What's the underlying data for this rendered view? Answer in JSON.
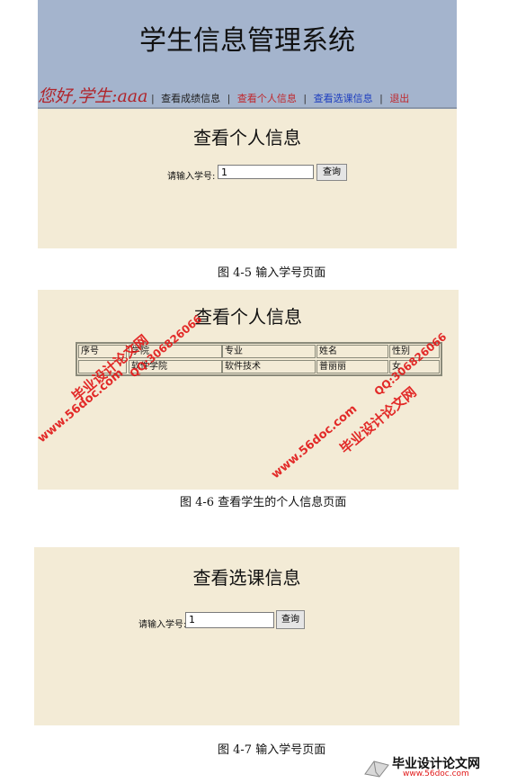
{
  "fig1": {
    "system_title": "学生信息管理系统",
    "greeting": "您好,学生:aaa",
    "nav": [
      {
        "label": "查看成绩信息",
        "color": "#222222"
      },
      {
        "label": "查看个人信息",
        "color": "#c0282d"
      },
      {
        "label": "查看选课信息",
        "color": "#1f3fbf"
      },
      {
        "label": "退出",
        "color": "#c0282d"
      }
    ],
    "heading": "查看个人信息",
    "label": "请输入学号:",
    "input_value": "1",
    "button": "查询"
  },
  "caption1": "图 4-5   输入学号页面",
  "fig2": {
    "heading": "查看个人信息",
    "headers": [
      "序号",
      "学院",
      "专业",
      "姓名",
      "性别"
    ],
    "row": [
      "",
      "软件学院",
      "软件技术",
      "普丽丽",
      "女"
    ],
    "watermarks": [
      "毕业设计论文网",
      "QQ:306826066",
      "www.56doc.com"
    ]
  },
  "caption2": "图 4-6   查看学生的个人信息页面",
  "fig3": {
    "heading": "查看选课信息",
    "label": "请输入学号:",
    "input_value": "1",
    "button": "查询"
  },
  "caption3": "图 4-7   输入学号页面",
  "footer": {
    "brand": "毕业设计论文网",
    "url": "www.56doc.com",
    "accent": "#e11a1a"
  }
}
